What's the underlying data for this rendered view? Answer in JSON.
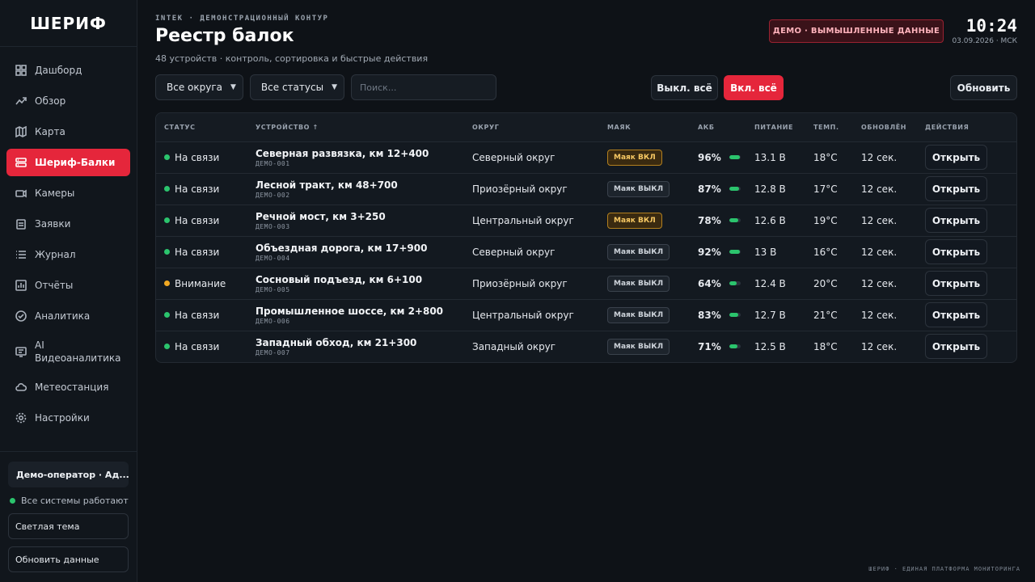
{
  "brand": "ШЕРИФ",
  "sidebar": {
    "items": [
      {
        "label": "Дашборд",
        "icon": "grid-icon"
      },
      {
        "label": "Обзор",
        "icon": "trend-icon"
      },
      {
        "label": "Карта",
        "icon": "map-icon"
      },
      {
        "label": "Шериф-Балки",
        "icon": "server-icon",
        "active": true
      },
      {
        "label": "Камеры",
        "icon": "camera-icon"
      },
      {
        "label": "Заявки",
        "icon": "clipboard-icon"
      },
      {
        "label": "Журнал",
        "icon": "list-icon"
      },
      {
        "label": "Отчёты",
        "icon": "chart-icon"
      },
      {
        "label": "Аналитика",
        "icon": "check-circle-icon"
      },
      {
        "label": "AI Видеоаналитика",
        "icon": "video-ai-icon"
      },
      {
        "label": "Метеостанция",
        "icon": "cloud-icon"
      },
      {
        "label": "Настройки",
        "icon": "gear-icon"
      }
    ],
    "operator": "Демо-оператор · Ад...",
    "system_status": "Все системы работают",
    "theme_button": "Светлая тема",
    "refresh_data_button": "Обновить данные"
  },
  "header": {
    "breadcrumb": "INTEK · ДЕМОНСТРАЦИОННЫЙ КОНТУР",
    "title": "Реестр балок",
    "subtitle": "48 устройств · контроль, сортировка и быстрые действия",
    "demo_badge": "ДЕМО · ВЫМЫШЛЕННЫЕ ДАННЫЕ",
    "time": "10:24",
    "date": "03.09.2026 · МСК"
  },
  "filters": {
    "district": "Все округа",
    "status": "Все статусы",
    "search_placeholder": "Поиск..."
  },
  "actions": {
    "all_off": "Выкл. всё",
    "all_on": "Вкл. всё",
    "refresh": "Обновить"
  },
  "table": {
    "columns": [
      "СТАТУС",
      "УСТРОЙСТВО ↑",
      "ОКРУГ",
      "МАЯК",
      "АКБ",
      "ПИТАНИЕ",
      "ТЕМП.",
      "ОБНОВЛЁН",
      "ДЕЙСТВИЯ"
    ],
    "open_label": "Открыть",
    "rows": [
      {
        "status": "На связи",
        "status_color": "#2bc46d",
        "name": "Северная развязка, км 12+400",
        "id": "ДЕМО-001",
        "district": "Северный округ",
        "beacon": "Маяк ВКЛ",
        "beacon_on": true,
        "battery": "96%",
        "battery_level": 0.96,
        "power": "13.1 В",
        "temp": "18°C",
        "updated": "12 сек."
      },
      {
        "status": "На связи",
        "status_color": "#2bc46d",
        "name": "Лесной тракт, км 48+700",
        "id": "ДЕМО-002",
        "district": "Приозёрный округ",
        "beacon": "Маяк ВЫКЛ",
        "beacon_on": false,
        "battery": "87%",
        "battery_level": 0.87,
        "power": "12.8 В",
        "temp": "17°C",
        "updated": "12 сек."
      },
      {
        "status": "На связи",
        "status_color": "#2bc46d",
        "name": "Речной мост, км 3+250",
        "id": "ДЕМО-003",
        "district": "Центральный округ",
        "beacon": "Маяк ВКЛ",
        "beacon_on": true,
        "battery": "78%",
        "battery_level": 0.78,
        "power": "12.6 В",
        "temp": "19°C",
        "updated": "12 сек."
      },
      {
        "status": "На связи",
        "status_color": "#2bc46d",
        "name": "Объездная дорога, км 17+900",
        "id": "ДЕМО-004",
        "district": "Северный округ",
        "beacon": "Маяк ВЫКЛ",
        "beacon_on": false,
        "battery": "92%",
        "battery_level": 0.92,
        "power": "13 В",
        "temp": "16°C",
        "updated": "12 сек."
      },
      {
        "status": "Внимание",
        "status_color": "#f0a822",
        "name": "Сосновый подъезд, км 6+100",
        "id": "ДЕМО-005",
        "district": "Приозёрный округ",
        "beacon": "Маяк ВЫКЛ",
        "beacon_on": false,
        "battery": "64%",
        "battery_level": 0.64,
        "power": "12.4 В",
        "temp": "20°C",
        "updated": "12 сек."
      },
      {
        "status": "На связи",
        "status_color": "#2bc46d",
        "name": "Промышленное шоссе, км 2+800",
        "id": "ДЕМО-006",
        "district": "Центральный округ",
        "beacon": "Маяк ВЫКЛ",
        "beacon_on": false,
        "battery": "83%",
        "battery_level": 0.83,
        "power": "12.7 В",
        "temp": "21°C",
        "updated": "12 сек."
      },
      {
        "status": "На связи",
        "status_color": "#2bc46d",
        "name": "Западный обход, км 21+300",
        "id": "ДЕМО-007",
        "district": "Западный округ",
        "beacon": "Маяк ВЫКЛ",
        "beacon_on": false,
        "battery": "71%",
        "battery_level": 0.71,
        "power": "12.5 В",
        "temp": "18°C",
        "updated": "12 сек."
      }
    ]
  },
  "footer": "ШЕРИФ · ЕДИНАЯ ПЛАТФОРМА МОНИТОРИНГА"
}
